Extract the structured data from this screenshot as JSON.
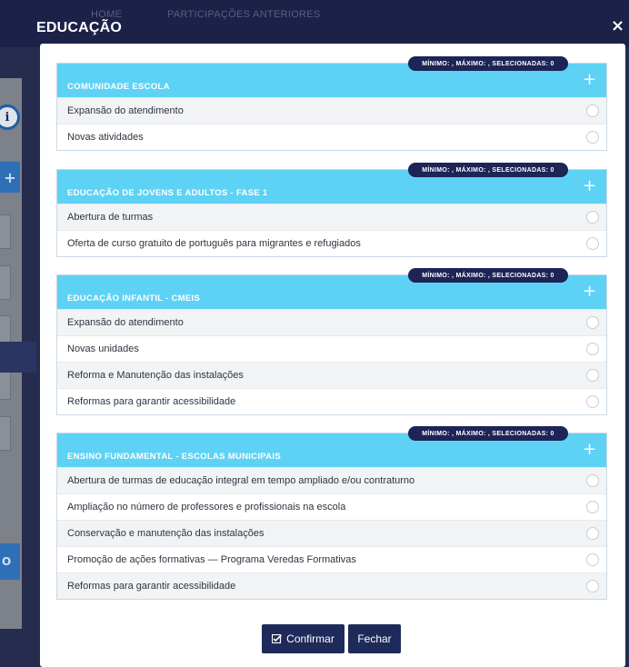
{
  "modal": {
    "title": "EDUCAÇÃO",
    "close_symbol": "×"
  },
  "badge_text": "MÍNIMO: , MÁXIMO: , SELECIONADAS: 0",
  "groups": [
    {
      "title": "COMUNIDADE ESCOLA",
      "items": [
        "Expansão do atendimento",
        "Novas atividades"
      ]
    },
    {
      "title": "EDUCAÇÃO DE JOVENS E ADULTOS - FASE 1",
      "items": [
        "Abertura de turmas",
        "Oferta de curso gratuito de português para migrantes e refugiados"
      ]
    },
    {
      "title": "EDUCAÇÃO INFANTIL - CMEIS",
      "items": [
        "Expansão do atendimento",
        "Novas unidades",
        "Reforma e Manutenção das instalações",
        "Reformas para garantir acessibilidade"
      ]
    },
    {
      "title": "ENSINO FUNDAMENTAL - ESCOLAS MUNICIPAIS",
      "items": [
        "Abertura de turmas de educação integral em tempo ampliado e/ou contraturno",
        "Ampliação no número de professores e profissionais na escola",
        "Conservação e manutenção das instalações",
        "Promoção de ações formativas — Programa Veredas Formativas",
        "Reformas para garantir acessibilidade"
      ]
    }
  ],
  "buttons": {
    "confirm": "Confirmar",
    "close": "Fechar"
  },
  "background": {
    "nav_home": "HOME",
    "nav_previous": "PARTICIPAÇÕES ANTERIORES",
    "info_icon": "i",
    "plus_symbol": "+",
    "button_fragment": "O"
  },
  "colors": {
    "panel_header": "#5ed2f5",
    "badge": "#1d2456",
    "buttons": "#1e2a59",
    "overlay": "#252c4e"
  },
  "icons": {
    "close": "close-icon",
    "plus": "plus-icon",
    "confirm": "check-square-icon",
    "info": "info-icon"
  }
}
